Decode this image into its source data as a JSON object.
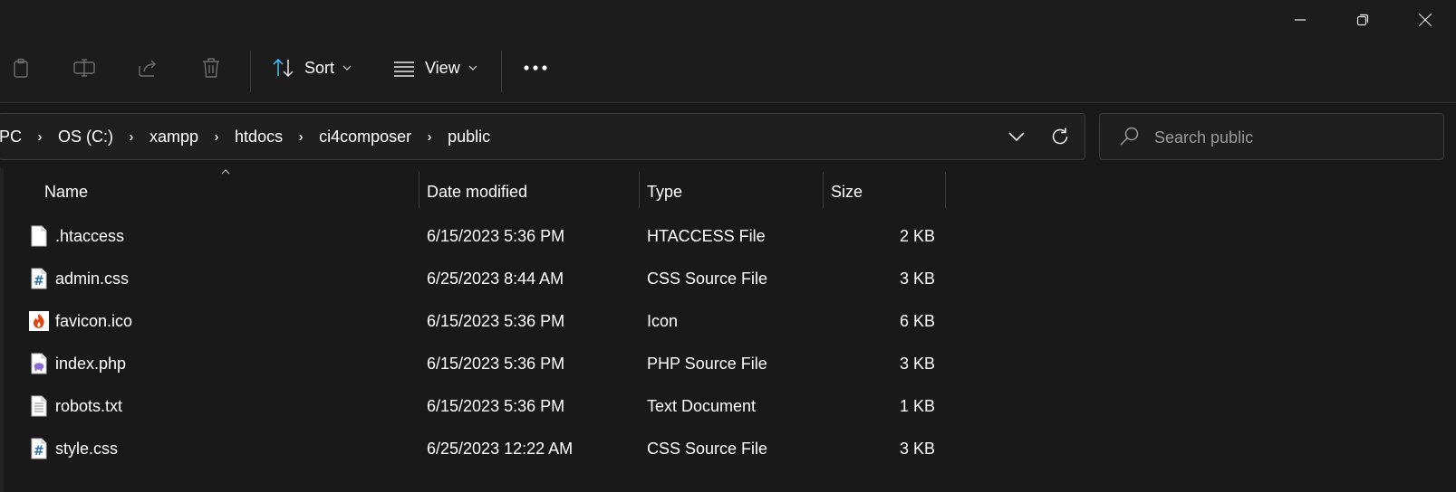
{
  "window": {
    "controls": [
      "minimize",
      "restore",
      "close"
    ]
  },
  "toolbar": {
    "sort_label": "Sort",
    "view_label": "View",
    "icons": [
      "copy-icon",
      "rename-icon",
      "share-icon",
      "delete-icon",
      "sort-icon",
      "view-icon",
      "more-icon"
    ]
  },
  "address": {
    "crumbs": [
      "PC",
      "OS (C:)",
      "xampp",
      "htdocs",
      "ci4composer",
      "public"
    ]
  },
  "search": {
    "placeholder": "Search public"
  },
  "columns": {
    "name": "Name",
    "date": "Date modified",
    "type": "Type",
    "size": "Size"
  },
  "files": [
    {
      "name": ".htaccess",
      "date": "6/15/2023 5:36 PM",
      "type": "HTACCESS File",
      "size": "2 KB",
      "icon": "blank-file-icon"
    },
    {
      "name": "admin.css",
      "date": "6/25/2023 8:44 AM",
      "type": "CSS Source File",
      "size": "3 KB",
      "icon": "css-file-icon"
    },
    {
      "name": "favicon.ico",
      "date": "6/15/2023 5:36 PM",
      "type": "Icon",
      "size": "6 KB",
      "icon": "codeigniter-icon"
    },
    {
      "name": "index.php",
      "date": "6/15/2023 5:36 PM",
      "type": "PHP Source File",
      "size": "3 KB",
      "icon": "php-file-icon"
    },
    {
      "name": "robots.txt",
      "date": "6/15/2023 5:36 PM",
      "type": "Text Document",
      "size": "1 KB",
      "icon": "text-file-icon"
    },
    {
      "name": "style.css",
      "date": "6/25/2023 12:22 AM",
      "type": "CSS Source File",
      "size": "3 KB",
      "icon": "css-file-icon"
    }
  ],
  "colors": {
    "background": "#191919",
    "accent": "#4cc2ff"
  }
}
